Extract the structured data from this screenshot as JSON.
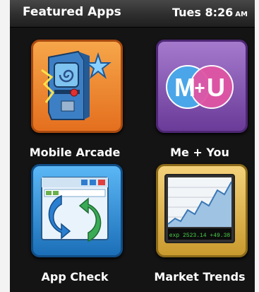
{
  "statusbar": {
    "title": "Featured Apps",
    "time": "Tues 8:26",
    "ampm": "AM"
  },
  "apps": [
    {
      "label": "Mobile Arcade",
      "icon": "arcade-icon",
      "color": "#e8822e"
    },
    {
      "label": "Me + You",
      "icon": "me-you-icon",
      "color": "#7b4ca8",
      "badge_left": "M",
      "badge_plus": "+",
      "badge_right": "U"
    },
    {
      "label": "App Check",
      "icon": "app-check-icon",
      "color": "#2a86d1"
    },
    {
      "label": "Market Trends",
      "icon": "market-trends-icon",
      "color": "#d9ad45",
      "ticker": "exp 2523.14 +49.38"
    }
  ]
}
